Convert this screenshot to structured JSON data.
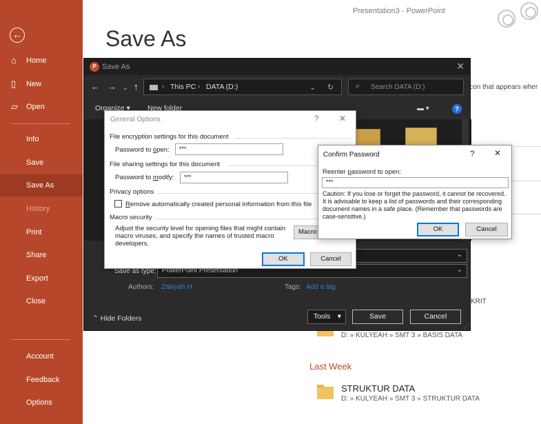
{
  "window": {
    "title": "Presentation3 - PowerPoint"
  },
  "backstage": {
    "heading": "Save As",
    "hint_text": "icon that appears wher",
    "recent_item_truncated": "KRIT",
    "recent_path_1": "D: » KULYEAH » SMT 3 » BASIS DATA",
    "last_week_label": "Last Week",
    "last_week_item": {
      "name": "STRUKTUR DATA",
      "path": "D: » KULYEAH » SMT 3 » STRUKTUR DATA"
    }
  },
  "rail": {
    "items": [
      {
        "label": "Home",
        "icon": "home-icon"
      },
      {
        "label": "New",
        "icon": "new-doc-icon"
      },
      {
        "label": "Open",
        "icon": "open-folder-icon"
      },
      {
        "label": "Info"
      },
      {
        "label": "Save"
      },
      {
        "label": "Save As",
        "active": true
      },
      {
        "label": "History",
        "disabled": true
      },
      {
        "label": "Print"
      },
      {
        "label": "Share"
      },
      {
        "label": "Export"
      },
      {
        "label": "Close"
      },
      {
        "label": "Account"
      },
      {
        "label": "Feedback"
      },
      {
        "label": "Options"
      }
    ]
  },
  "save_dialog": {
    "title": "Save As",
    "breadcrumb": [
      "This PC",
      "DATA (D:)"
    ],
    "search_placeholder": "Search DATA (D:)",
    "organize_label": "Organize ▾",
    "new_folder_label": "New folder",
    "save_as_type_label": "Save as type:",
    "save_as_type_value": "PowerPoint Presentation",
    "authors_label": "Authors:",
    "authors_value": "Zakiyah H",
    "tags_label": "Tags:",
    "tags_value": "Add a tag",
    "hide_folders_label": "Hide Folders",
    "tools_label": "Tools",
    "save_label": "Save",
    "cancel_label": "Cancel"
  },
  "general_options": {
    "title": "General Options",
    "encryption_section": "File encryption settings for this document",
    "password_open_label_pre": "Password to ",
    "password_open_label_u": "o",
    "password_open_label_post": "pen:",
    "password_open_value": "***",
    "sharing_section": "File sharing settings for this document",
    "password_modify_label_pre": "Password to ",
    "password_modify_label_u": "m",
    "password_modify_label_post": "odify:",
    "password_modify_value": "***",
    "privacy_section": "Privacy options",
    "privacy_checkbox_pre": "",
    "privacy_checkbox_u": "R",
    "privacy_checkbox_post": "emove automatically created personal information from this file",
    "privacy_checked": false,
    "macro_section": "Macro security",
    "macro_text": "Adjust the security level for opening files that might contain macro viruses, and specify the names of trusted macro developers.",
    "macro_button": "Macro",
    "ok_label": "OK",
    "cancel_label": "Cancel"
  },
  "confirm_password": {
    "title": "Confirm Password",
    "reenter_label_pre": "Reenter ",
    "reenter_label_u": "p",
    "reenter_label_post": "assword to open:",
    "value": "***",
    "caution": "Caution: If you lose or forget the password, it cannot be recovered. It is advisable to keep a list of passwords and their corresponding document names in a safe place. (Remember that passwords are case-sensitive.)",
    "ok_label": "OK",
    "cancel_label": "Cancel"
  },
  "colors": {
    "rail": "#b7472a",
    "rail_active": "#9c3b22",
    "accent_blue": "#0078d7",
    "dialog_dark": "#2b2b2b"
  }
}
